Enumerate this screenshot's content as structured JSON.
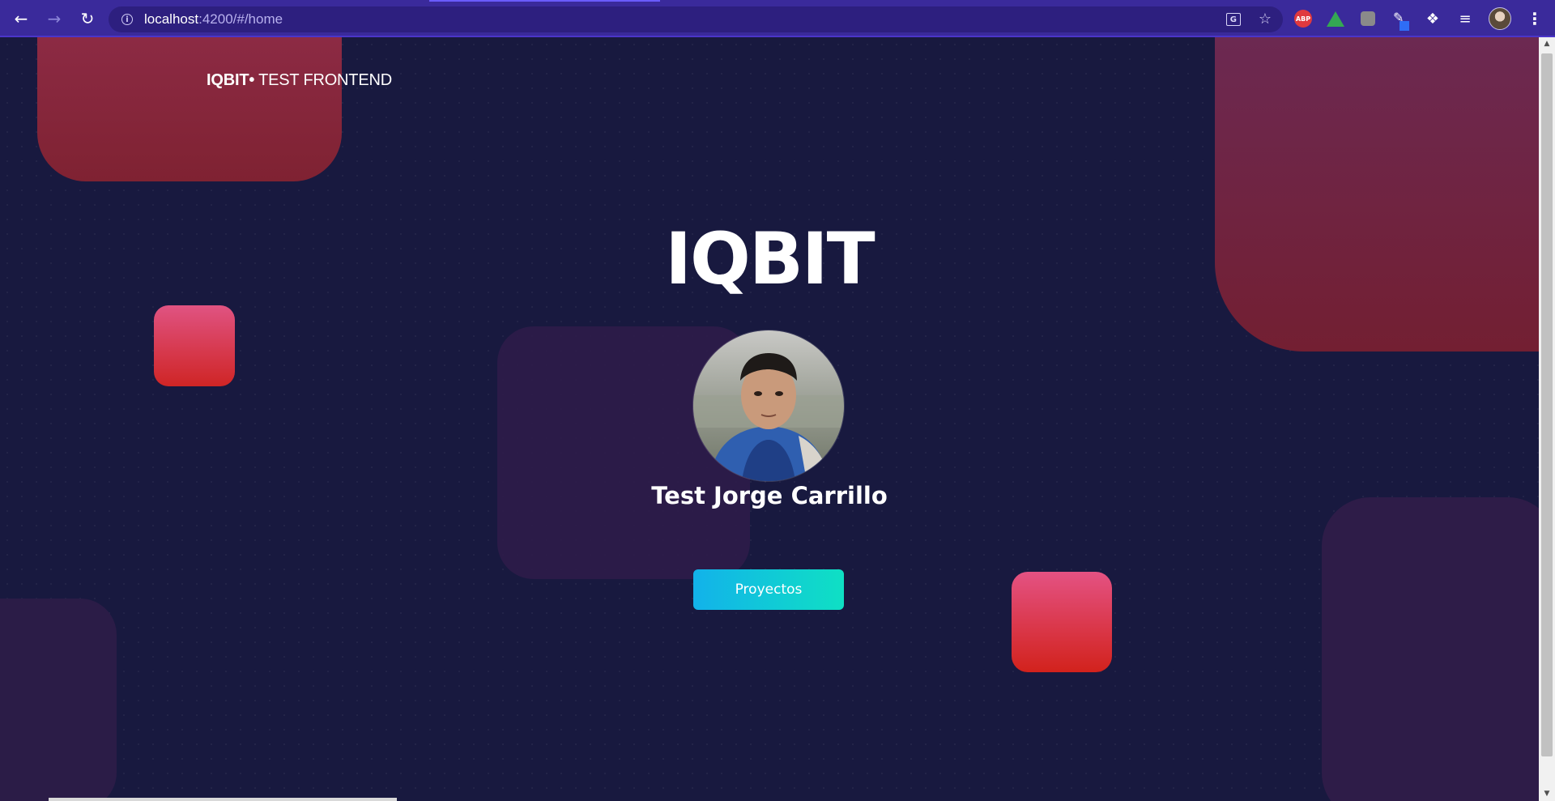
{
  "browser": {
    "url_host": "localhost",
    "url_path": ":4200/#/home",
    "back_icon": "arrow-left-icon",
    "forward_icon": "arrow-right-icon",
    "reload_icon": "reload-icon",
    "extensions": [
      "adblock-plus-icon",
      "google-drive-icon",
      "extension-icon",
      "pen-extension-icon",
      "puzzle-icon",
      "reading-list-icon",
      "profile-avatar",
      "menu-icon"
    ],
    "abp_label": "ABP"
  },
  "header": {
    "brand_strong": "IQBIT•",
    "brand_rest": " TEST FRONTEND"
  },
  "hero": {
    "title": "IQBIT",
    "name": "Test Jorge Carrillo",
    "button_label": "Proyectos"
  },
  "colors": {
    "page_background": "#18193f",
    "button_gradient_start": "#12b2ea",
    "button_gradient_end": "#0fe0c4",
    "accent_red": "#cf2525",
    "accent_pink": "#e05382",
    "browser_chrome": "#3a2a9b"
  }
}
